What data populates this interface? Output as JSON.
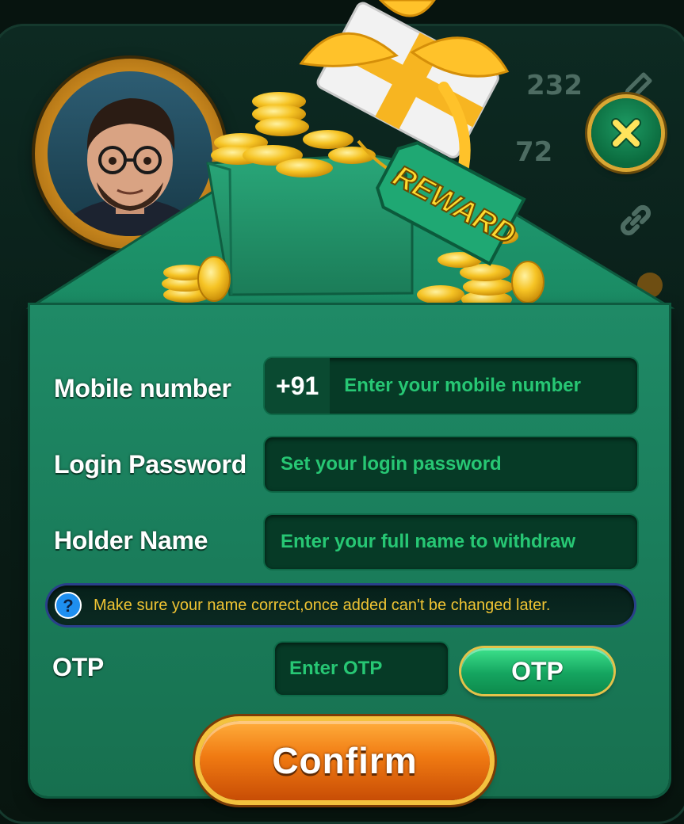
{
  "background": {
    "stat_1": "232",
    "stat_2": "72"
  },
  "reward_tag": "REWARD",
  "form": {
    "mobile": {
      "label": "Mobile number",
      "prefix": "+91",
      "placeholder": "Enter your mobile number",
      "value": ""
    },
    "password": {
      "label": "Login Password",
      "placeholder": "Set your login password",
      "value": ""
    },
    "holder": {
      "label": "Holder Name",
      "placeholder": "Enter your full name to withdraw",
      "value": ""
    },
    "notice": {
      "icon": "question-icon",
      "text": "Make sure your name correct,once added can't be changed later."
    },
    "otp": {
      "label": "OTP",
      "placeholder": "Enter OTP",
      "value": "",
      "button_label": "OTP"
    },
    "confirm_label": "Confirm"
  },
  "colors": {
    "card_green": "#1f8a66",
    "field_bg": "#063a26",
    "placeholder_green": "#27c774",
    "notice_text": "#f0c433",
    "confirm_orange": "#f07a12",
    "gold": "#f4c23e"
  }
}
